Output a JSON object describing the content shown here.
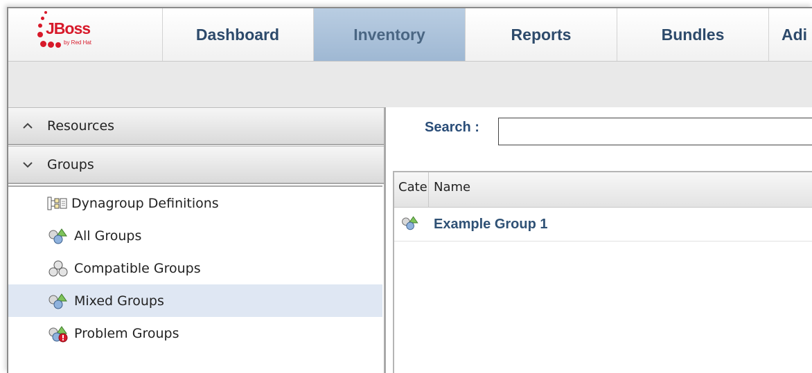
{
  "logo": {
    "wordmark": "JBoss",
    "byline": "by Red Hat"
  },
  "nav": {
    "tabs": [
      {
        "label": "Dashboard",
        "active": false
      },
      {
        "label": "Inventory",
        "active": true
      },
      {
        "label": "Reports",
        "active": false
      },
      {
        "label": "Bundles",
        "active": false
      },
      {
        "label": "Adi",
        "active": false
      }
    ]
  },
  "left": {
    "sections": [
      {
        "label": "Resources",
        "chevron": "chevron-up-icon"
      },
      {
        "label": "Groups",
        "chevron": "chevron-down-icon"
      }
    ],
    "tree": [
      {
        "label": "Dynagroup Definitions",
        "icon": "dynagroup-icon",
        "selected": false
      },
      {
        "label": "All Groups",
        "icon": "mixed-group-icon",
        "selected": false
      },
      {
        "label": "Compatible Groups",
        "icon": "compatible-group-icon",
        "selected": false
      },
      {
        "label": "Mixed Groups",
        "icon": "mixed-group-icon",
        "selected": true
      },
      {
        "label": "Problem Groups",
        "icon": "problem-group-icon",
        "selected": false
      }
    ]
  },
  "search": {
    "label": "Search :",
    "value": "",
    "placeholder": ""
  },
  "table": {
    "columns": [
      "Cate",
      "Name"
    ],
    "rows": [
      {
        "icon": "mixed-group-icon",
        "name": "Example Group 1"
      }
    ]
  },
  "colors": {
    "brand_red": "#d7192a",
    "active_tab": "#a9c0d9",
    "link_blue": "#2f5175",
    "selected_row": "#dfe7f3"
  }
}
